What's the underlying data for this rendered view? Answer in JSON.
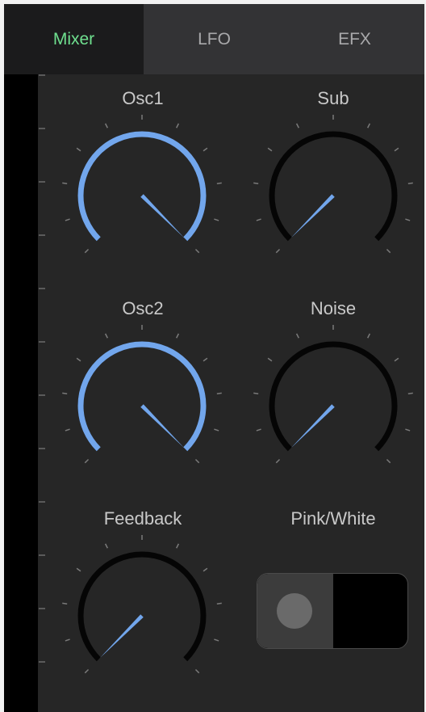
{
  "tabs": [
    {
      "label": "Mixer",
      "active": true
    },
    {
      "label": "LFO",
      "active": false
    },
    {
      "label": "EFX",
      "active": false
    }
  ],
  "knobs": {
    "osc1": {
      "label": "Osc1",
      "value": 1.0,
      "unipolar": true
    },
    "sub": {
      "label": "Sub",
      "value": 0.0,
      "unipolar": true
    },
    "osc2": {
      "label": "Osc2",
      "value": 1.0,
      "unipolar": true
    },
    "noise": {
      "label": "Noise",
      "value": 0.0,
      "unipolar": true
    },
    "feedback": {
      "label": "Feedback",
      "value": 0.0,
      "unipolar": true
    }
  },
  "toggle": {
    "label": "Pink/White",
    "state": "Pink"
  },
  "colors": {
    "accent": "#72a6ec",
    "track": "#050505",
    "active_tab_text": "#6fe08f",
    "tab_text": "#a9a9ab",
    "tick": "#7a7a7a",
    "background": "#262626"
  }
}
